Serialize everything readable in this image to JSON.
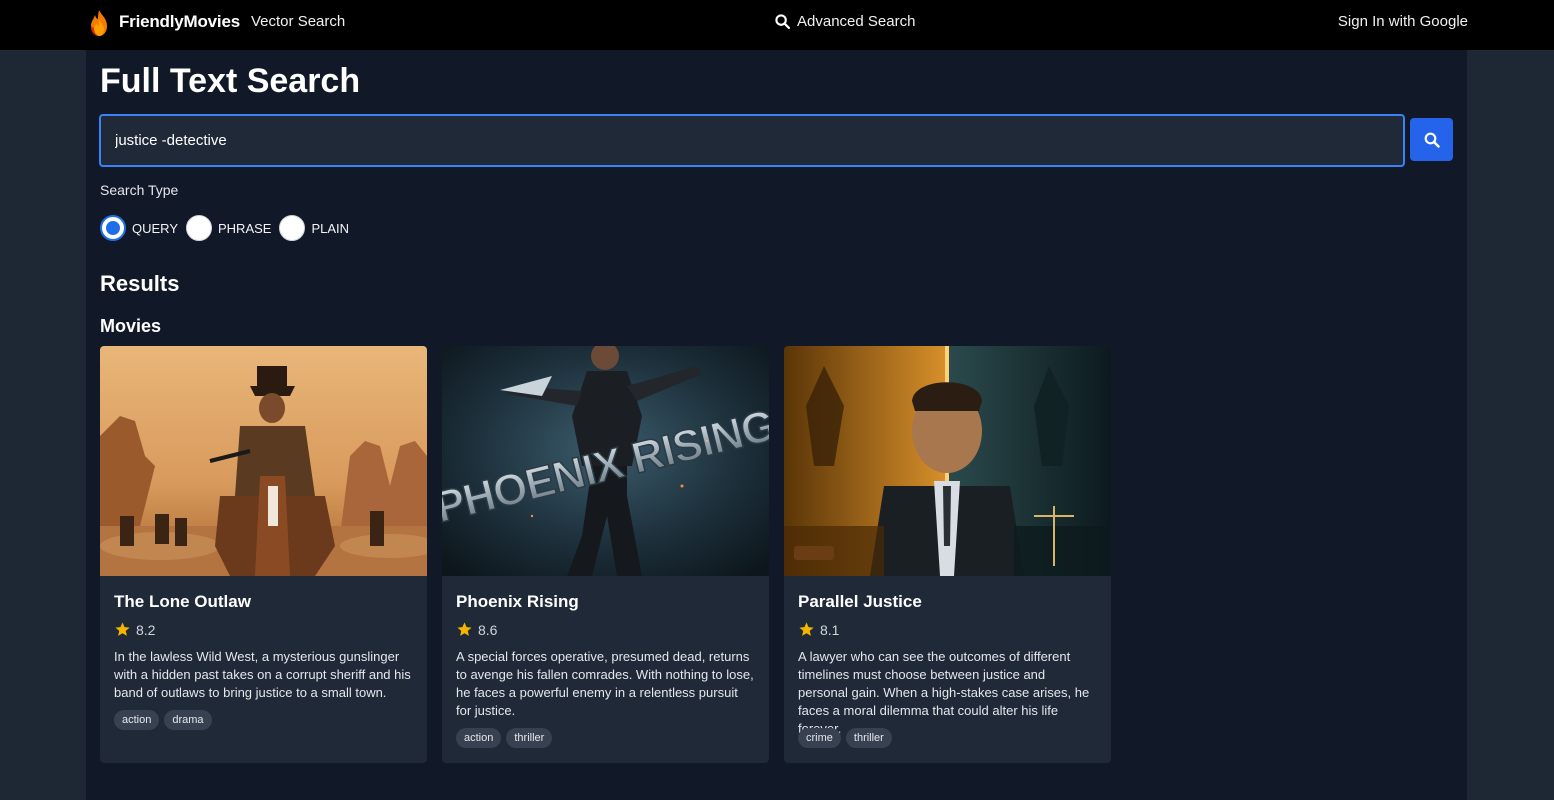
{
  "nav": {
    "brand": "FriendlyMovies",
    "vector_search": "Vector Search",
    "advanced_search": "Advanced Search",
    "sign_in": "Sign In with Google"
  },
  "page": {
    "title": "Full Text Search"
  },
  "search": {
    "value": "justice -detective"
  },
  "search_type": {
    "label": "Search Type",
    "options": [
      "QUERY",
      "PHRASE",
      "PLAIN"
    ],
    "selected": "QUERY"
  },
  "results": {
    "heading": "Results",
    "movies_heading": "Movies",
    "movies": [
      {
        "title": "The Lone Outlaw",
        "rating": "8.2",
        "description": "In the lawless Wild West, a mysterious gunslinger with a hidden past takes on a corrupt sheriff and his band of outlaws to bring justice to a small town.",
        "tags": [
          "action",
          "drama"
        ]
      },
      {
        "title": "Phoenix Rising",
        "rating": "8.6",
        "description": "A special forces operative, presumed dead, returns to avenge his fallen comrades. With nothing to lose, he faces a powerful enemy in a relentless pursuit for justice.",
        "tags": [
          "action",
          "thriller"
        ],
        "poster_text": "PHOENIX RISING"
      },
      {
        "title": "Parallel Justice",
        "rating": "8.1",
        "description": "A lawyer who can see the outcomes of different timelines must choose between justice and personal gain. When a high-stakes case arises, he faces a moral dilemma that could alter his life forever.",
        "tags": [
          "crime",
          "thriller"
        ]
      }
    ]
  },
  "colors": {
    "accent": "#2563eb",
    "star": "#f5b400",
    "topbar": "#000000",
    "panel": "#111827",
    "card": "#1f2937"
  },
  "icons": [
    "flame-logo-icon",
    "search-icon",
    "star-icon"
  ]
}
